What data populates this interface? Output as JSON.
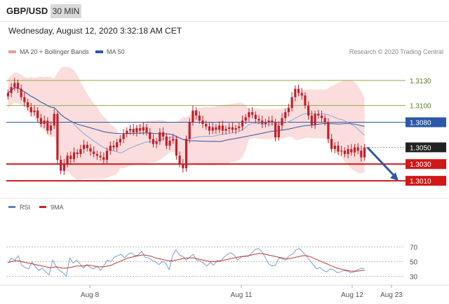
{
  "header": {
    "pair": "GBP/USD",
    "timeframe": "30 MIN",
    "datetime": "Wednesday, August 12, 2020 3:32:18 AM CET"
  },
  "legend": {
    "ma20_label": "MA 20 + Bollinger Bands",
    "ma50_label": "MA 50",
    "credit": "Research © 2020 Trading Central"
  },
  "rsi_legend": {
    "rsi_label": "RSI",
    "ma_label": "9MA"
  },
  "colors": {
    "candle": "#c0202a",
    "band": "#f9d2d2",
    "ma20": "#8aaad8",
    "ma50": "#2b58a8",
    "support": "#d01818",
    "resistance": "#8fae4a",
    "pivot": "#2b58a8",
    "arrow": "#2a5a9e",
    "current_tag": "#222222"
  },
  "chart_data": [
    {
      "type": "candlestick",
      "ylim": [
        1.299,
        1.3155
      ],
      "x_ticks": [
        "Aug 8",
        "Aug 11",
        "Aug 12",
        "Aug 23"
      ],
      "levels": [
        {
          "label": "1.3130",
          "value": 1.313,
          "kind": "resistance"
        },
        {
          "label": "1.3100",
          "value": 1.31,
          "kind": "resistance"
        },
        {
          "label": "1.3080",
          "value": 1.308,
          "kind": "pivot"
        },
        {
          "label": "1.3050",
          "value": 1.305,
          "kind": "current"
        },
        {
          "label": "1.3030",
          "value": 1.303,
          "kind": "support"
        },
        {
          "label": "1.3010",
          "value": 1.301,
          "kind": "support"
        }
      ],
      "close": [
        1.3115,
        1.3122,
        1.3127,
        1.312,
        1.311,
        1.3104,
        1.3098,
        1.3092,
        1.3094,
        1.3085,
        1.3078,
        1.3082,
        1.307,
        1.3076,
        1.309,
        1.3035,
        1.3022,
        1.303,
        1.304,
        1.3036,
        1.3044,
        1.3042,
        1.3048,
        1.3053,
        1.3049,
        1.3045,
        1.3042,
        1.304,
        1.3038,
        1.3035,
        1.3046,
        1.3052,
        1.305,
        1.3056,
        1.306,
        1.3066,
        1.307,
        1.3072,
        1.3068,
        1.3073,
        1.307,
        1.3074,
        1.3068,
        1.306,
        1.3054,
        1.3057,
        1.3068,
        1.3063,
        1.3052,
        1.3058,
        1.306,
        1.304,
        1.303,
        1.3025,
        1.306,
        1.308,
        1.3094,
        1.3088,
        1.3082,
        1.3078,
        1.3075,
        1.307,
        1.3074,
        1.3071,
        1.3076,
        1.307,
        1.3072,
        1.3074,
        1.3071,
        1.3073,
        1.3075,
        1.3082,
        1.3086,
        1.3092,
        1.3089,
        1.3084,
        1.3082,
        1.3078,
        1.308,
        1.3082,
        1.308,
        1.3062,
        1.3076,
        1.3085,
        1.3092,
        1.3097,
        1.311,
        1.312,
        1.3115,
        1.3112,
        1.31,
        1.3088,
        1.3077,
        1.309,
        1.3088,
        1.3085,
        1.308,
        1.306,
        1.3048,
        1.3052,
        1.3045,
        1.3046,
        1.3042,
        1.3048,
        1.3044,
        1.305,
        1.3046,
        1.3038,
        1.305
      ]
    },
    {
      "type": "line",
      "title": "",
      "series": [
        {
          "name": "RSI",
          "values": [
            48,
            55,
            52,
            58,
            45,
            42,
            40,
            50,
            43,
            38,
            41,
            36,
            32,
            52,
            44,
            38,
            35,
            30,
            55,
            48,
            52,
            47,
            41,
            46,
            42,
            40,
            44,
            38,
            45,
            52,
            50,
            56,
            58,
            60,
            55,
            60,
            62,
            58,
            59,
            64,
            56,
            55,
            52,
            50,
            46,
            50,
            48,
            39,
            58,
            66,
            59,
            57,
            52,
            56,
            60,
            52,
            51,
            48,
            44,
            49,
            45,
            52,
            50,
            56,
            60,
            62,
            59,
            52,
            56,
            58,
            57,
            61,
            66,
            68,
            64,
            56,
            47,
            44,
            45,
            55,
            54,
            52,
            58,
            60,
            66,
            68,
            63,
            58,
            52,
            46,
            40,
            42,
            38,
            36,
            40,
            39,
            35,
            36,
            38,
            37,
            35,
            36,
            39,
            41,
            40
          ]
        },
        {
          "name": "9MA",
          "values": [
            49,
            50,
            51,
            51,
            50,
            49,
            48,
            47,
            46,
            45,
            44,
            43,
            42,
            42,
            43,
            42,
            41,
            41,
            42,
            43,
            44,
            44,
            44,
            45,
            45,
            44,
            43,
            43,
            43,
            44,
            45,
            47,
            49,
            51,
            53,
            55,
            56,
            57,
            58,
            59,
            59,
            58,
            57,
            55,
            54,
            53,
            52,
            51,
            51,
            52,
            53,
            54,
            55,
            55,
            55,
            54,
            53,
            52,
            51,
            50,
            50,
            50,
            51,
            52,
            53,
            54,
            55,
            56,
            57,
            57,
            58,
            59,
            60,
            61,
            61,
            60,
            59,
            58,
            57,
            56,
            55,
            54,
            54,
            55,
            56,
            57,
            58,
            58,
            57,
            55,
            53,
            51,
            49,
            47,
            45,
            43,
            41,
            40,
            39,
            38,
            37,
            37,
            37,
            38,
            38
          ]
        }
      ],
      "ylim": [
        20,
        80
      ],
      "y_ticks": [
        70,
        50,
        30
      ]
    }
  ]
}
